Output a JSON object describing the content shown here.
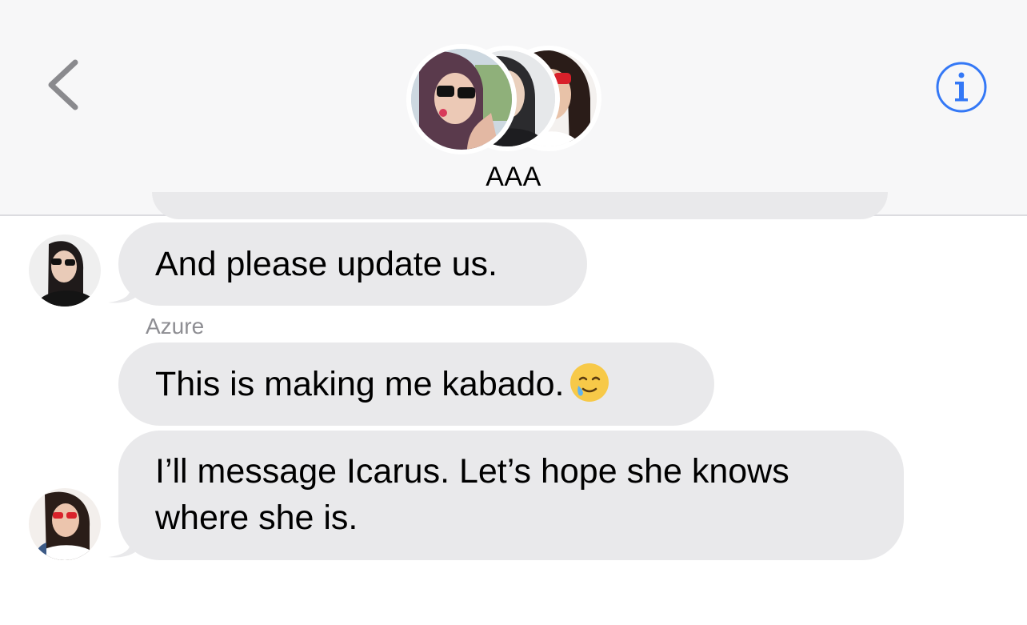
{
  "header": {
    "title": "AAA",
    "back_icon": "chevron-left-icon",
    "info_icon": "info-circle-icon",
    "accent_color": "#3478f6"
  },
  "messages": [
    {
      "text": "And please update us.",
      "avatar": "participant-1",
      "show_avatar": true
    },
    {
      "sender": "Azure",
      "text": "This is making me kabado.",
      "emoji": "smiling-face-with-tear",
      "show_avatar": false
    },
    {
      "text_line1": "I’ll message Icarus. Let’s hope she knows",
      "text_line2": "where she is.",
      "avatar": "participant-2",
      "show_avatar": true
    }
  ],
  "colors": {
    "header_bg": "#f7f7f8",
    "bubble_bg": "#e9e9eb",
    "sender_name": "#8e8e93"
  }
}
